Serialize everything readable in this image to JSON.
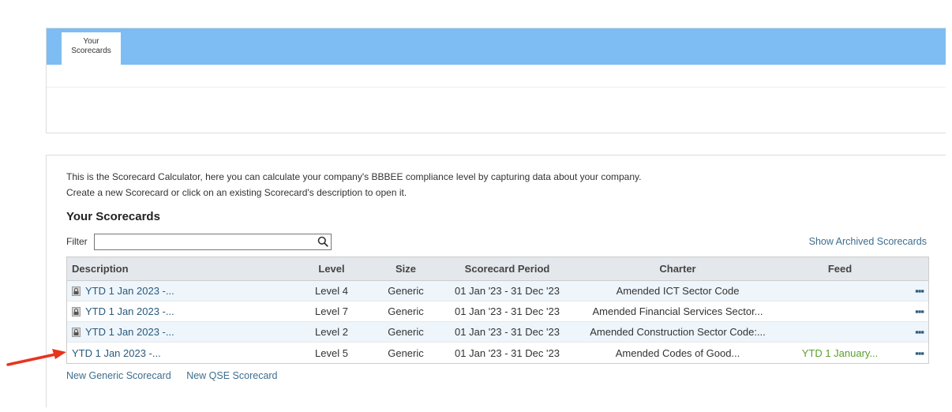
{
  "tabs": [
    {
      "label_line1": "Your",
      "label_line2": "Scorecards"
    }
  ],
  "intro": {
    "line1": "This is the Scorecard Calculator, here you can calculate your company's BBBEE compliance level by capturing data about your company.",
    "line2": "Create a new Scorecard or click on an existing Scorecard's description to open it."
  },
  "section_title": "Your Scorecards",
  "filter": {
    "label": "Filter",
    "value": "",
    "placeholder": ""
  },
  "archived_link": "Show Archived Scorecards",
  "table": {
    "headers": {
      "description": "Description",
      "level": "Level",
      "size": "Size",
      "period": "Scorecard Period",
      "charter": "Charter",
      "feed": "Feed"
    },
    "rows": [
      {
        "description": "YTD 1 Jan 2023 -...",
        "locked": true,
        "level": "Level 4",
        "size": "Generic",
        "period": "01 Jan '23 - 31 Dec '23",
        "charter": "Amended ICT Sector Code",
        "feed": "",
        "actions": "▪▪▪"
      },
      {
        "description": "YTD 1 Jan 2023 -...",
        "locked": true,
        "level": "Level 7",
        "size": "Generic",
        "period": "01 Jan '23 - 31 Dec '23",
        "charter": "Amended Financial Services Sector...",
        "feed": "",
        "actions": "▪▪▪"
      },
      {
        "description": "YTD 1 Jan 2023 -...",
        "locked": true,
        "level": "Level 2",
        "size": "Generic",
        "period": "01 Jan '23 - 31 Dec '23",
        "charter": "Amended Construction Sector Code:...",
        "feed": "",
        "actions": "▪▪▪"
      },
      {
        "description": "YTD 1 Jan 2023 -...",
        "locked": false,
        "level": "Level 5",
        "size": "Generic",
        "period": "01 Jan '23 - 31 Dec '23",
        "charter": "Amended Codes of Good...",
        "feed": "YTD 1 January...",
        "actions": "▪▪▪"
      }
    ]
  },
  "footer": {
    "new_generic": "New Generic Scorecard",
    "new_qse": "New QSE Scorecard"
  },
  "colors": {
    "tab_bar": "#7dbdf3",
    "link": "#2a5a7c",
    "feed": "#5aa02c",
    "arrow": "#e8341c"
  }
}
